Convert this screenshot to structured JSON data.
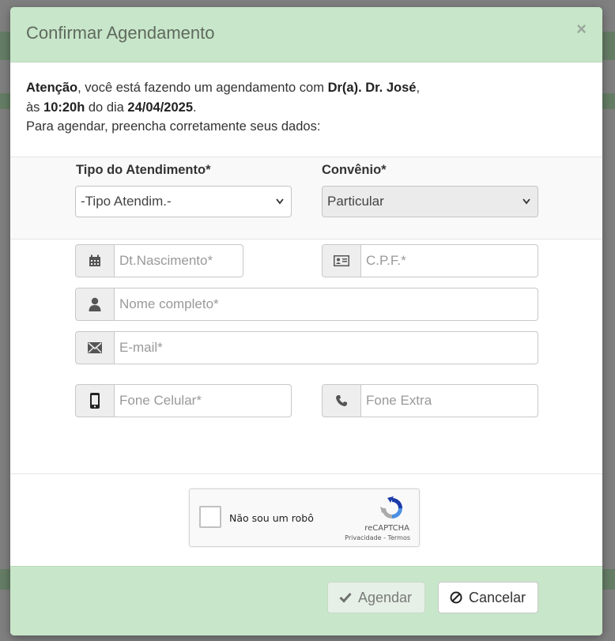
{
  "modal": {
    "title": "Confirmar Agendamento",
    "close_symbol": "×",
    "intro": {
      "attention": "Atenção",
      "text1": ", você está fazendo um agendamento com ",
      "doctor": "Dr(a). Dr. José",
      "text2": ",",
      "at": "às ",
      "time": "10:20h",
      "day_text": " do dia ",
      "date": "24/04/2025",
      "period": ".",
      "instruction": "Para agendar, preencha corretamente seus dados:"
    },
    "tipo_atendimento": {
      "label": "Tipo do Atendimento*",
      "selected": "-Tipo Atendim.-"
    },
    "convenio": {
      "label": "Convênio*",
      "selected": "Particular"
    },
    "fields": {
      "nascimento": {
        "placeholder": "Dt.Nascimento*",
        "icon": "calendar-icon"
      },
      "cpf": {
        "placeholder": "C.P.F.*",
        "icon": "id-card-icon"
      },
      "nome": {
        "placeholder": "Nome completo*",
        "icon": "user-icon"
      },
      "email": {
        "placeholder": "E-mail*",
        "icon": "envelope-icon"
      },
      "celular": {
        "placeholder": "Fone Celular*",
        "icon": "mobile-phone-icon"
      },
      "extra": {
        "placeholder": "Fone Extra",
        "icon": "phone-icon"
      }
    },
    "captcha": {
      "label": "Não sou um robô",
      "brand": "reCAPTCHA",
      "links": "Privacidade - Termos"
    },
    "footer": {
      "agendar": "Agendar",
      "cancelar": "Cancelar"
    }
  },
  "colors": {
    "header_bg": "#c8e6c9",
    "footer_bg": "#c8e6c9",
    "overlay": "#808080"
  }
}
